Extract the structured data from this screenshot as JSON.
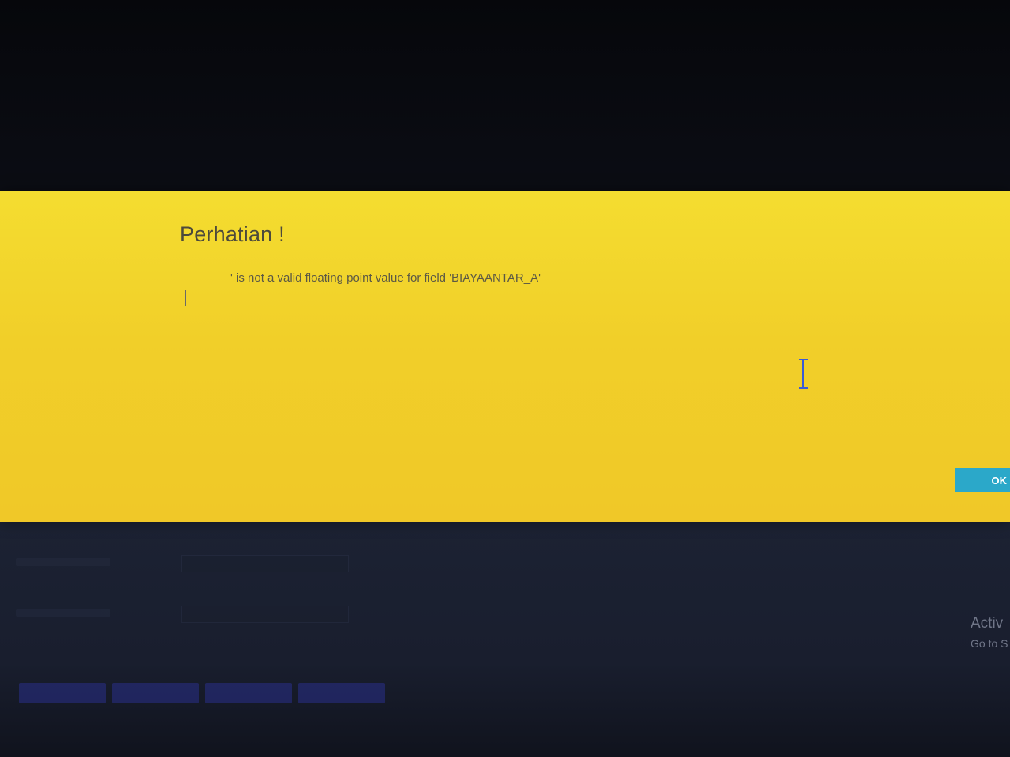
{
  "dialog": {
    "title": "Perhatian !",
    "message": "' is not a valid floating point value for field 'BIAYAANTAR_A'",
    "ok_label": "OK",
    "background_color": "#f1cf29",
    "ok_color": "#2ba8c9"
  },
  "watermark": {
    "line1": "Activ",
    "line2": "Go to S"
  },
  "cursor": {
    "icon": "text-cursor-icon"
  }
}
